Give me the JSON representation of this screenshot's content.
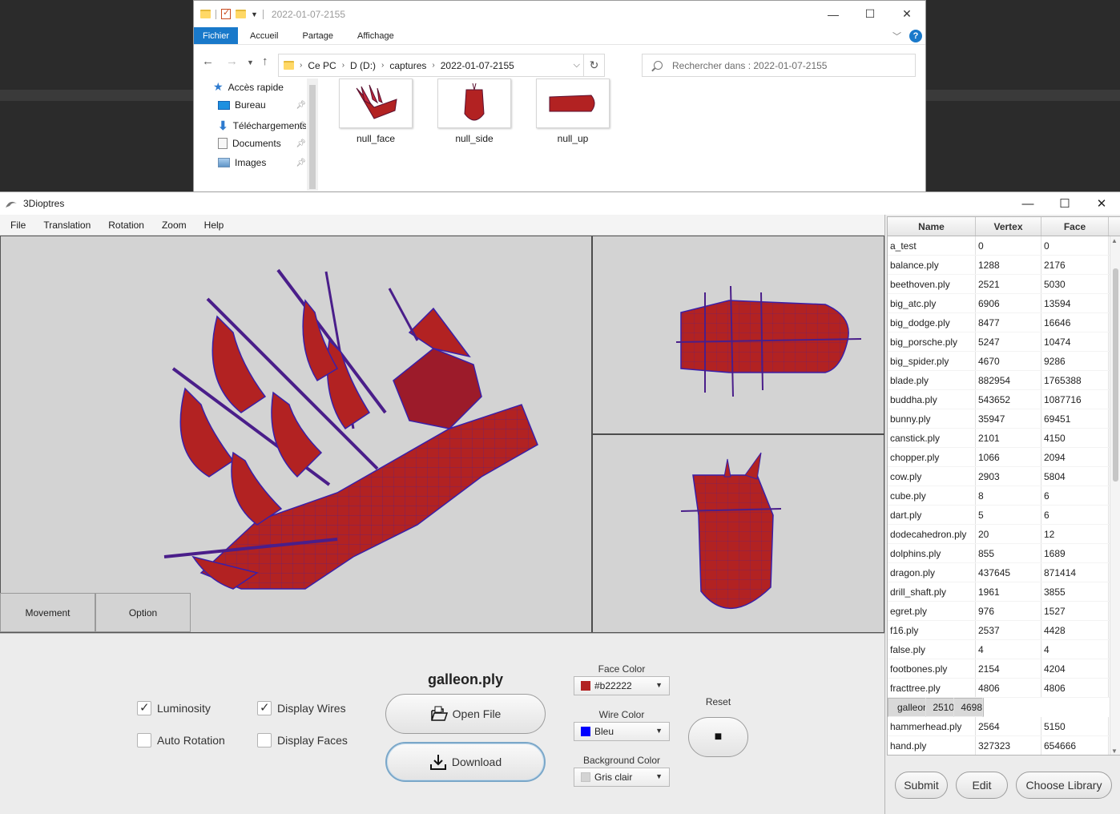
{
  "explorer": {
    "title": "2022-01-07-2155",
    "window_controls": [
      "—",
      "☐",
      "✕"
    ],
    "ribbon_tabs": [
      "Fichier",
      "Accueil",
      "Partage",
      "Affichage"
    ],
    "help": "?",
    "path": [
      "Ce PC",
      "D (D:)",
      "captures",
      "2022-01-07-2155"
    ],
    "search_placeholder": "Rechercher dans : 2022-01-07-2155",
    "nav": [
      {
        "label": "Accès rapide",
        "icon": "star-icon"
      },
      {
        "label": "Bureau",
        "icon": "desktop-icon"
      },
      {
        "label": "Téléchargements",
        "icon": "download-arrow-icon"
      },
      {
        "label": "Documents",
        "icon": "document-icon"
      },
      {
        "label": "Images",
        "icon": "pictures-icon"
      }
    ],
    "files": [
      "null_face",
      "null_side",
      "null_up"
    ]
  },
  "app": {
    "title": "3Dioptres",
    "window_controls": [
      "—",
      "☐",
      "✕"
    ],
    "menu": [
      "File",
      "Translation",
      "Rotation",
      "Zoom",
      "Help"
    ],
    "tabs": [
      "Movement",
      "Option"
    ],
    "options": {
      "luminosity": {
        "label": "Luminosity",
        "checked": true
      },
      "display_wires": {
        "label": "Display Wires",
        "checked": true
      },
      "auto_rotation": {
        "label": "Auto Rotation",
        "checked": false
      },
      "display_faces": {
        "label": "Display Faces",
        "checked": false
      }
    },
    "file_name": "galleon.ply",
    "open_file": "Open File",
    "download": "Download",
    "face_color": {
      "label": "Face Color",
      "value": "#b22222",
      "swatch": "#b22222"
    },
    "wire_color": {
      "label": "Wire Color",
      "value": "Bleu",
      "swatch": "#0000ff"
    },
    "background_color": {
      "label": "Background Color",
      "value": "Gris clair",
      "swatch": "#d3d3d3"
    },
    "reset_label": "Reset",
    "reset_glyph": "■",
    "model_color": "#b22222",
    "wire_stroke": "#3a1fa8"
  },
  "library": {
    "columns": [
      "Name",
      "Vertex",
      "Face"
    ],
    "selected": "galleon.ply",
    "rows": [
      [
        "a_test",
        "0",
        "0"
      ],
      [
        "balance.ply",
        "1288",
        "2176"
      ],
      [
        "beethoven.ply",
        "2521",
        "5030"
      ],
      [
        "big_atc.ply",
        "6906",
        "13594"
      ],
      [
        "big_dodge.ply",
        "8477",
        "16646"
      ],
      [
        "big_porsche.ply",
        "5247",
        "10474"
      ],
      [
        "big_spider.ply",
        "4670",
        "9286"
      ],
      [
        "blade.ply",
        "882954",
        "1765388"
      ],
      [
        "buddha.ply",
        "543652",
        "1087716"
      ],
      [
        "bunny.ply",
        "35947",
        "69451"
      ],
      [
        "canstick.ply",
        "2101",
        "4150"
      ],
      [
        "chopper.ply",
        "1066",
        "2094"
      ],
      [
        "cow.ply",
        "2903",
        "5804"
      ],
      [
        "cube.ply",
        "8",
        "6"
      ],
      [
        "dart.ply",
        "5",
        "6"
      ],
      [
        "dodecahedron.ply",
        "20",
        "12"
      ],
      [
        "dolphins.ply",
        "855",
        "1689"
      ],
      [
        "dragon.ply",
        "437645",
        "871414"
      ],
      [
        "drill_shaft.ply",
        "1961",
        "3855"
      ],
      [
        "egret.ply",
        "976",
        "1527"
      ],
      [
        "f16.ply",
        "2537",
        "4428"
      ],
      [
        "false.ply",
        "4",
        "4"
      ],
      [
        "footbones.ply",
        "2154",
        "4204"
      ],
      [
        "fracttree.ply",
        "4806",
        "4806"
      ],
      [
        "galleon.ply",
        "2510",
        "4698"
      ],
      [
        "hammerhead.ply",
        "2564",
        "5150"
      ],
      [
        "hand.ply",
        "327323",
        "654666"
      ]
    ],
    "buttons": [
      "Submit",
      "Edit",
      "Choose Library"
    ]
  }
}
